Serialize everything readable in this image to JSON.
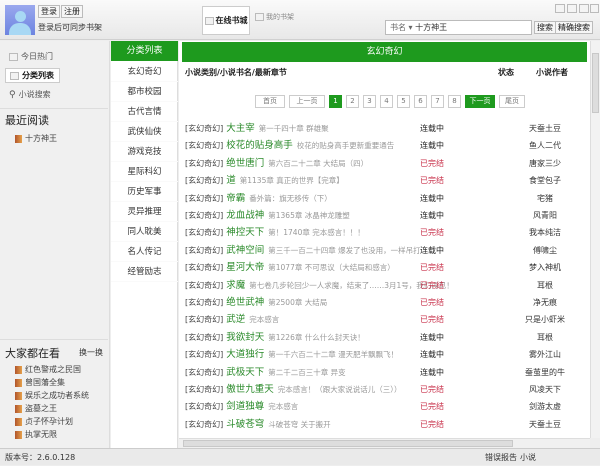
{
  "header": {
    "login": "登录",
    "register": "注册",
    "sync_hint": "登录后可同步书架",
    "tab_online": "在线书城",
    "tab_shelf": "我的书架",
    "search_type": "书名 ▾",
    "search_value": "十方神王",
    "search_btn": "搜索",
    "exact_search_btn": "精确搜索"
  },
  "left": {
    "nav": [
      "今日热门",
      "分类列表",
      "小说搜索"
    ],
    "recent_title": "最近阅读",
    "recent": [
      "十方神王"
    ],
    "popular_title": "大家都在看",
    "refresh": "换一换",
    "popular": [
      "红色警戒之民国",
      "曾国藩全集",
      "娱乐之成功者系统",
      "盗墓之王",
      "贞子怀孕计划",
      "执掌无限"
    ],
    "version": "版本号：2.6.0.128"
  },
  "categories": {
    "title": "分类列表",
    "items": [
      "玄幻奇幻",
      "都市校园",
      "古代言情",
      "武侠仙侠",
      "游戏竞技",
      "星际科幻",
      "历史军事",
      "灵异推理",
      "同人耽美",
      "名人传记",
      "经管励志"
    ]
  },
  "main": {
    "title": "玄幻奇幻",
    "col_book": "小说类别/小说书名/最新章节",
    "col_status": "状态",
    "col_author": "小说作者",
    "pagination": {
      "first": "首页",
      "prev": "上一页",
      "pages": [
        "1",
        "2",
        "3",
        "4",
        "5",
        "6",
        "7",
        "8"
      ],
      "current": "1",
      "next": "下一页",
      "last": "尾页"
    },
    "rows": [
      {
        "cat": "[玄幻奇幻]",
        "title": "大主宰",
        "chapter": "第一千四十章 群雄聚",
        "status": "连载中",
        "author": "天蚕土豆"
      },
      {
        "cat": "[玄幻奇幻]",
        "title": "校花的贴身高手",
        "chapter": "校花的贴身高手更新重要通告",
        "status": "连载中",
        "author": "鱼人二代"
      },
      {
        "cat": "[玄幻奇幻]",
        "title": "绝世唐门",
        "chapter": "第六百二十二章 大结局（四）",
        "status": "已完结",
        "author": "唐家三少"
      },
      {
        "cat": "[玄幻奇幻]",
        "title": "道",
        "chapter": "第1135章 真正的世界【完章】",
        "status": "已完结",
        "author": "食堂包子"
      },
      {
        "cat": "[玄幻奇幻]",
        "title": "帝霸",
        "chapter": "番外篇：旗无移传（下）",
        "status": "连载中",
        "author": "宅猪"
      },
      {
        "cat": "[玄幻奇幻]",
        "title": "龙血战神",
        "chapter": "第1365章 冰晶神龙雕塑",
        "status": "连载中",
        "author": "风青阳"
      },
      {
        "cat": "[玄幻奇幻]",
        "title": "神控天下",
        "chapter": "第！1740章 完本感言！！！",
        "status": "已完结",
        "author": "我本纯洁"
      },
      {
        "cat": "[玄幻奇幻]",
        "title": "武神空间",
        "chapter": "第三千一百二十四章 爆发了也没用，一样吊打",
        "status": "连载中",
        "author": "傅啸尘"
      },
      {
        "cat": "[玄幻奇幻]",
        "title": "星河大帝",
        "chapter": "第1077章 不可思议（大结局和感言）",
        "status": "已完结",
        "author": "梦入神机"
      },
      {
        "cat": "[玄幻奇幻]",
        "title": "求魔",
        "chapter": "第七卷几步轮回少一人求魔，结束了……3月1号，我们再见！",
        "status": "已完结",
        "author": "耳根"
      },
      {
        "cat": "[玄幻奇幻]",
        "title": "绝世武神",
        "chapter": "第2500章 大结局",
        "status": "已完结",
        "author": "净无痕"
      },
      {
        "cat": "[玄幻奇幻]",
        "title": "武逆",
        "chapter": "完本感言",
        "status": "已完结",
        "author": "只是小虾米"
      },
      {
        "cat": "[玄幻奇幻]",
        "title": "我欲封天",
        "chapter": "第1226章 什么什么封天诀！",
        "status": "连载中",
        "author": "耳根"
      },
      {
        "cat": "[玄幻奇幻]",
        "title": "大道独行",
        "chapter": "第一千六百二十二章 漫天肥羊飘飘飞！",
        "status": "连载中",
        "author": "雾外江山"
      },
      {
        "cat": "[玄幻奇幻]",
        "title": "武极天下",
        "chapter": "第二千二百三十章 异变",
        "status": "连载中",
        "author": "蚕茧里的牛"
      },
      {
        "cat": "[玄幻奇幻]",
        "title": "傲世九重天",
        "chapter": "完本感言！（跟大家说说话儿（三））",
        "status": "已完结",
        "author": "风凌天下"
      },
      {
        "cat": "[玄幻奇幻]",
        "title": "剑道独尊",
        "chapter": "完本感言",
        "status": "已完结",
        "author": "剑游太虚"
      },
      {
        "cat": "[玄幻奇幻]",
        "title": "斗破苍穹",
        "chapter": "斗破苍穹 关于搬开",
        "status": "已完结",
        "author": "天蚕土豆"
      }
    ]
  },
  "status": {
    "error_report": "错误报告",
    "about": "小说"
  }
}
